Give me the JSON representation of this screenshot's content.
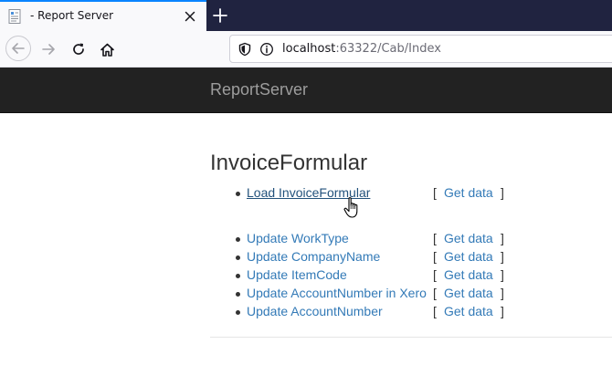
{
  "browser": {
    "tab": {
      "title": "- Report Server",
      "favicon": "document-icon",
      "close": "close-icon"
    },
    "new_tab": "plus-icon",
    "nav": {
      "back": "arrow-left-icon",
      "forward": "arrow-right-icon",
      "reload": "reload-icon",
      "home": "home-icon"
    },
    "address": {
      "host": "localhost",
      "rest": ":63322/Cab/Index",
      "security_icon": "shield-icon",
      "info_icon": "info-icon"
    }
  },
  "site": {
    "brand": "ReportServer"
  },
  "page": {
    "title": "InvoiceFormular",
    "primary": [
      {
        "label": "Load InvoiceFormular",
        "action": "Get data",
        "open": "[",
        "close": "]"
      }
    ],
    "updates": [
      {
        "label": "Update WorkType",
        "action": "Get data",
        "open": "[",
        "close": "]"
      },
      {
        "label": "Update CompanyName",
        "action": "Get data",
        "open": "[",
        "close": "]"
      },
      {
        "label": "Update ItemCode",
        "action": "Get data",
        "open": "[",
        "close": "]"
      },
      {
        "label": "Update AccountNumber in Xero",
        "action": "Get data",
        "open": "[",
        "close": "]"
      },
      {
        "label": "Update AccountNumber",
        "action": "Get data",
        "open": "[",
        "close": "]"
      }
    ]
  },
  "colors": {
    "link": "#337ab7",
    "link_hover": "#23527c",
    "header_bg": "#222222",
    "brand": "#9d9d9d",
    "tab_accent": "#0a84ff"
  },
  "cursor": "hand-pointer-icon"
}
